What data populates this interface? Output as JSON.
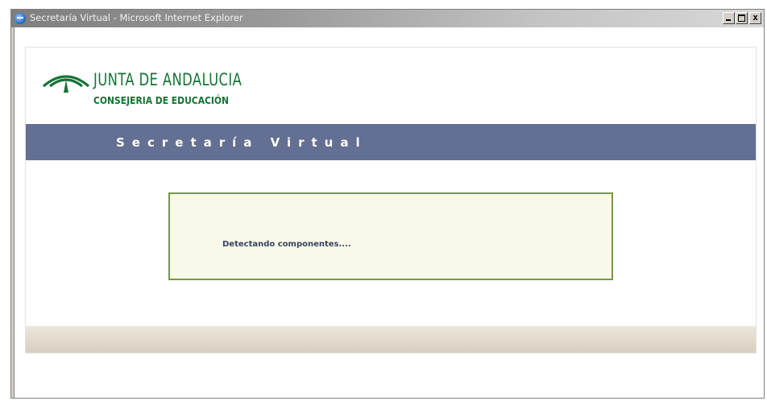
{
  "window": {
    "title": "Secretaría Virtual - Microsoft Internet Explorer",
    "buttons": {
      "minimize": "_",
      "maximize": "□",
      "close": "x"
    }
  },
  "header": {
    "logo_main": "JUNTA DE ANDALUCIA",
    "logo_sub": "CONSEJERIA DE EDUCACIÓN"
  },
  "banner": {
    "title": "Secretaría Virtual"
  },
  "status": {
    "message": "Detectando componentes...."
  },
  "colors": {
    "brand_green": "#157335",
    "banner_bg": "#636f93",
    "box_border": "#76993a",
    "box_bg": "#f8f9ea"
  },
  "icons": {
    "window_icon": "internet-explorer-icon",
    "logo": "junta-andalucia-arch-icon"
  }
}
